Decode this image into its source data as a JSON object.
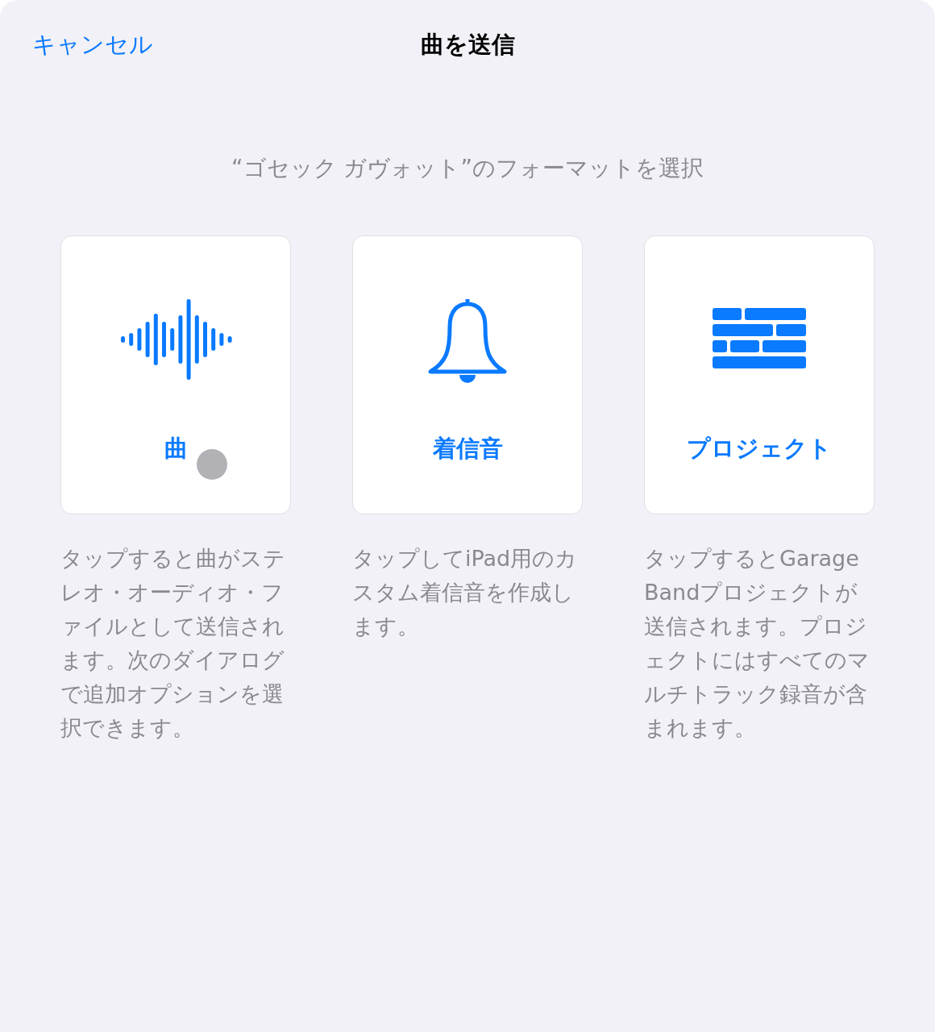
{
  "nav": {
    "cancel": "キャンセル",
    "title": "曲を送信"
  },
  "subtitle": "“ゴセック ガヴォット”のフォーマットを選択",
  "options": [
    {
      "kind": "waveform",
      "label": "曲",
      "touched": true,
      "description": "タップすると曲がステレオ・オーディオ・ファイルとして送信されます。次のダイアログで追加オプションを選択できます。"
    },
    {
      "kind": "bell",
      "label": "着信音",
      "touched": false,
      "description": "タップしてiPad用のカスタム着信音を作成します。"
    },
    {
      "kind": "bricks",
      "label": "プロジェクト",
      "touched": false,
      "description": "タップするとGarageBandプロジェクトが送信されます。プロジェクトにはすべてのマルチトラック録音が含まれます。"
    }
  ]
}
